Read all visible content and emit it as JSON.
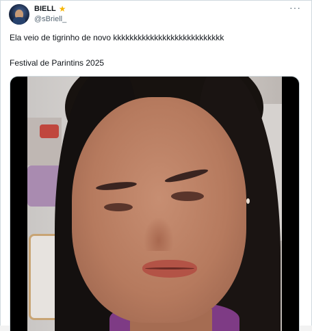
{
  "author": {
    "display_name": "BIELL",
    "handle": "@sBriell_",
    "badge_icon": "star-icon"
  },
  "menu": {
    "more_label": "···"
  },
  "tweet": {
    "line1": "Ela veio de tigrinho de novo kkkkkkkkkkkkkkkkkkkkkkkkkkk",
    "line2": "Festival de Parintins 2025"
  },
  "media": {
    "type": "video"
  },
  "colors": {
    "accent_star": "#f7b500",
    "secondary_text": "#536471",
    "border": "#cfd9de"
  }
}
